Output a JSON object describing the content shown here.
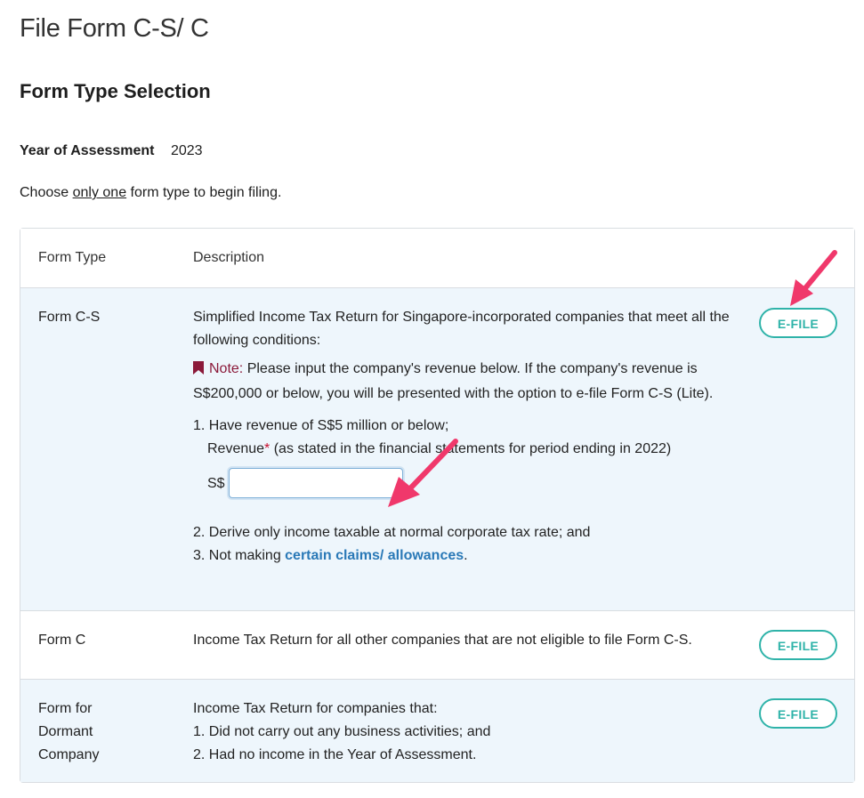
{
  "page": {
    "title": "File Form C-S/ C"
  },
  "section": {
    "title": "Form Type Selection"
  },
  "year_of_assessment": {
    "label": "Year of Assessment",
    "value": "2023"
  },
  "instruction": {
    "before": "Choose ",
    "emphasis": "only one",
    "after": " form type to begin filing."
  },
  "table": {
    "headers": {
      "form_type": "Form Type",
      "description": "Description"
    },
    "rows": [
      {
        "form_type": "Form C-S",
        "description": "Simplified Income Tax Return for Singapore-incorporated companies that meet all the following conditions:",
        "note_label": "Note:",
        "note_text": " Please input the company's revenue below. If the company's revenue is S$200,000 or below, you will be presented with the option to e-file Form C-S (Lite).",
        "condition_1": "1. Have revenue of S$5 million or below;",
        "revenue_label": "Revenue",
        "revenue_required": "*",
        "revenue_hint": " (as stated in the financial statements for period ending in 2022)",
        "currency": "S$",
        "revenue_value": "",
        "condition_2": "2. Derive only income taxable at normal corporate tax rate; and",
        "condition_3_prefix": "3. Not making ",
        "condition_3_link": "certain claims/ allowances",
        "condition_3_suffix": ".",
        "button": "E-FILE"
      },
      {
        "form_type": "Form C",
        "description": "Income Tax Return for all other companies that are not eligible to file Form C-S.",
        "button": "E-FILE"
      },
      {
        "form_type": "Form for Dormant Company",
        "description_line_0": "Income Tax Return for companies that:",
        "description_line_1": "1. Did not carry out any business activities; and",
        "description_line_2": "2. Had no income in the Year of Assessment.",
        "button": "E-FILE"
      }
    ]
  },
  "colors": {
    "accent_teal": "#2fb3a9",
    "link_blue": "#2a79b7",
    "note_maroon": "#8b1a3a",
    "row_highlight": "#eef6fc",
    "annotation_arrow": "#f0386b"
  }
}
